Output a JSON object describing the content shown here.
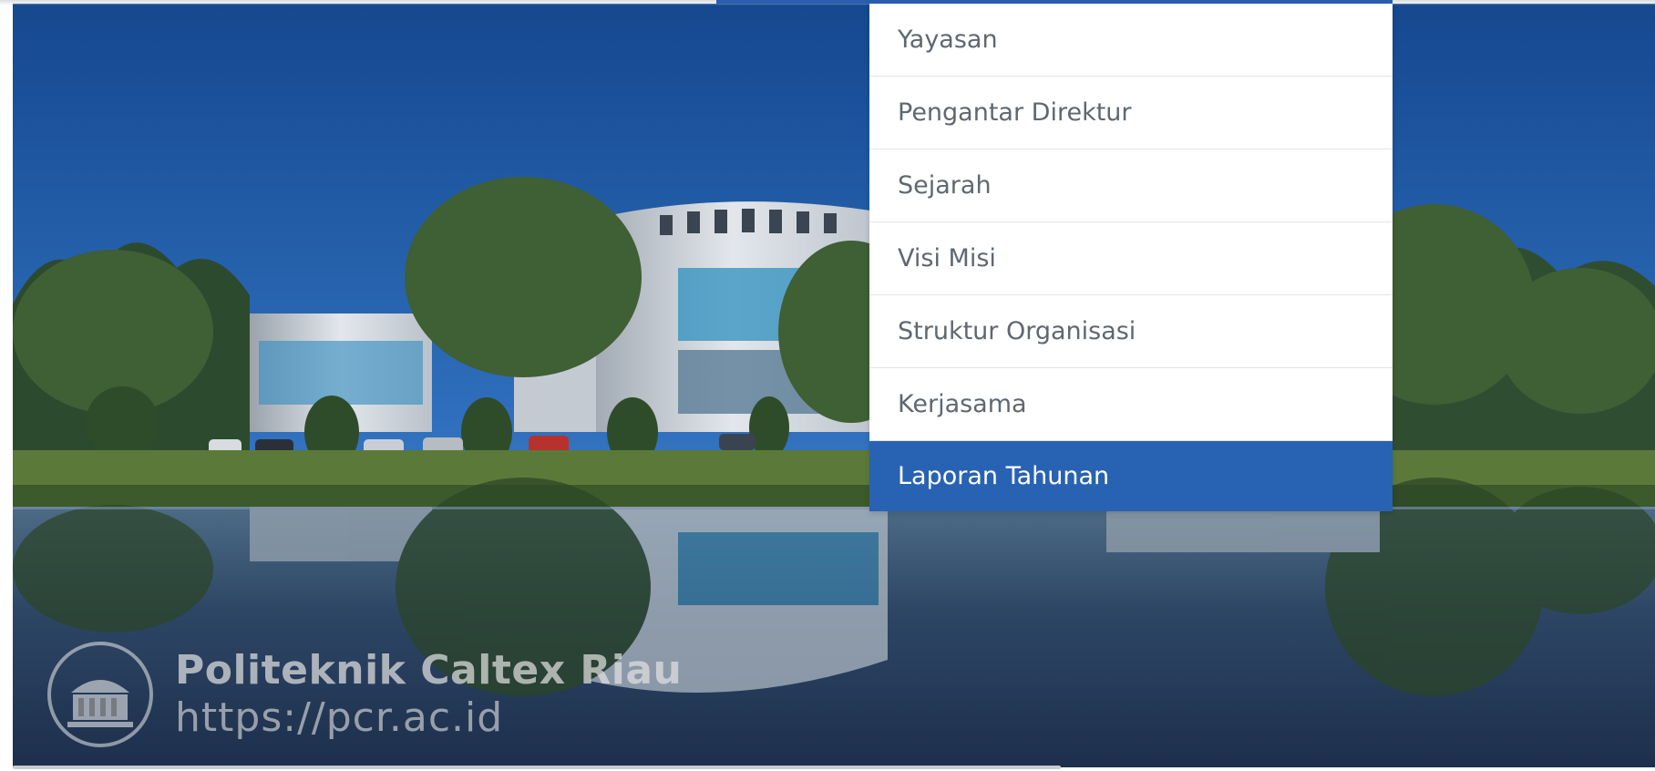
{
  "dropdown": {
    "items": [
      {
        "label": "Yayasan"
      },
      {
        "label": "Pengantar Direktur"
      },
      {
        "label": "Sejarah"
      },
      {
        "label": "Visi Misi"
      },
      {
        "label": "Struktur Organisasi"
      },
      {
        "label": "Kerjasama"
      },
      {
        "label": "Laporan Tahunan"
      }
    ],
    "active_index": 6,
    "active_color": "#2862b3",
    "text_color": "#5f6770"
  },
  "hero": {
    "watermark_title": "Politeknik Caltex Riau",
    "watermark_url": "https://pcr.ac.id",
    "sky_color": "#1d5aa8",
    "water_color": "#2b3f5c"
  },
  "colors": {
    "accent": "#2a5fb0"
  }
}
